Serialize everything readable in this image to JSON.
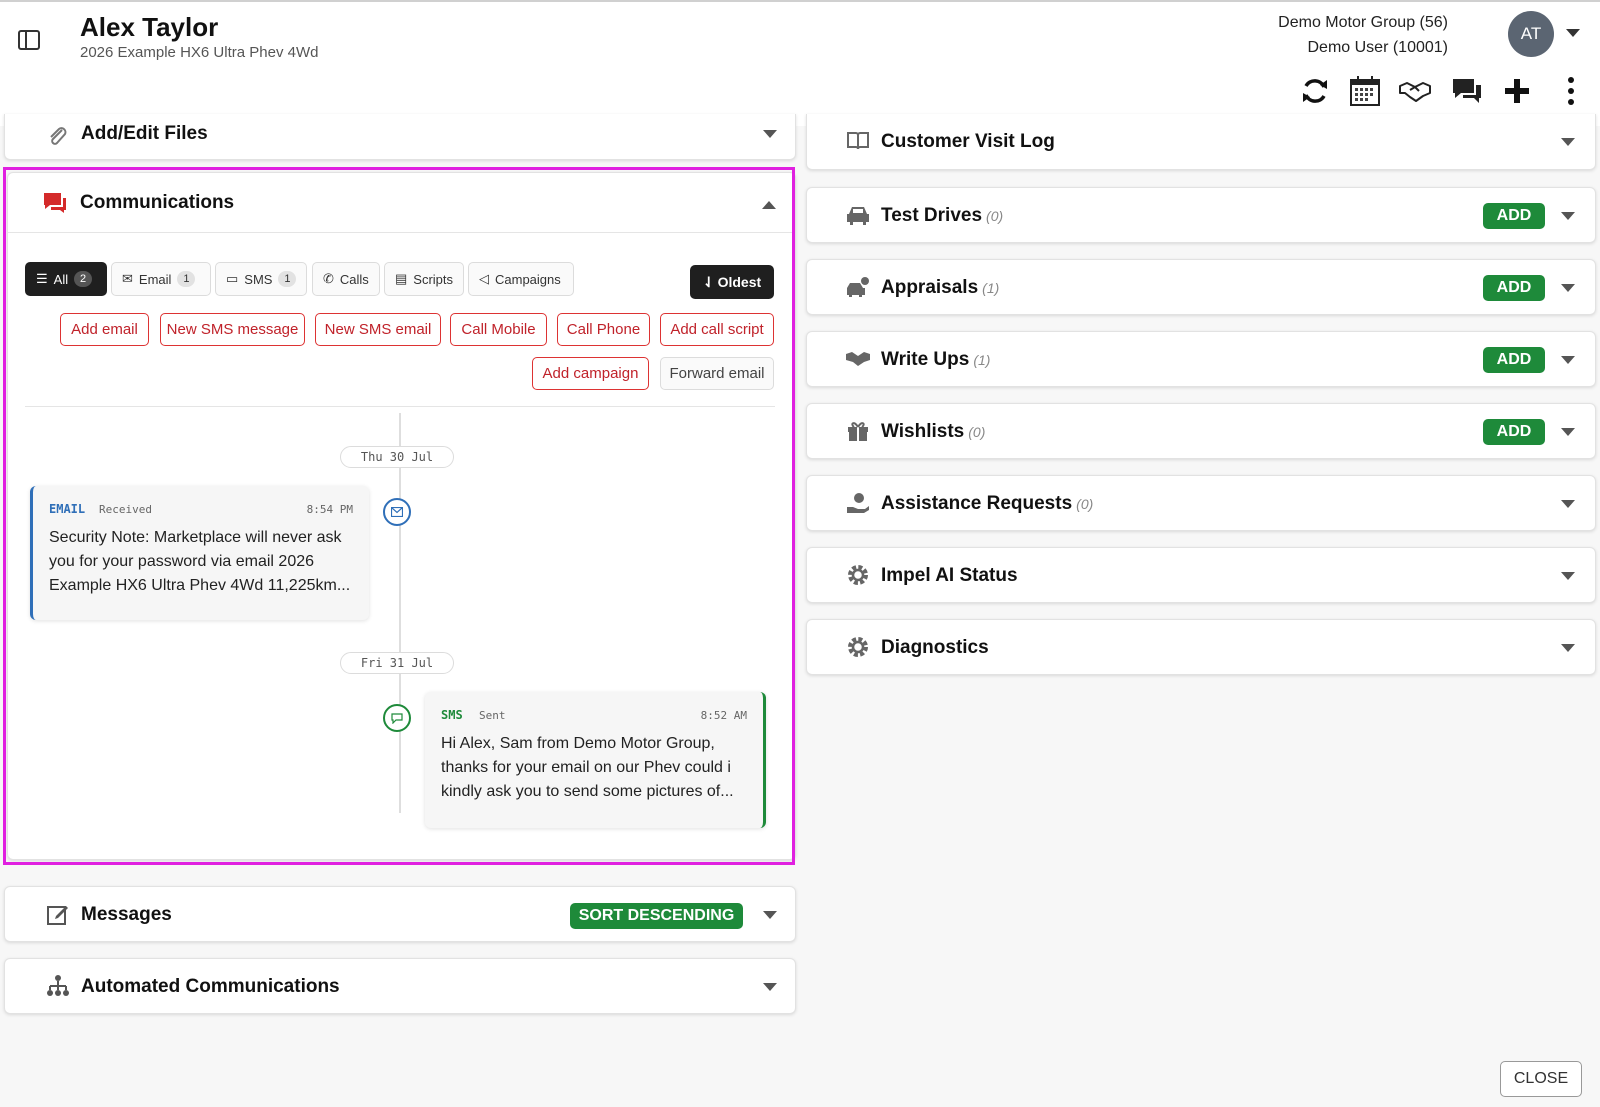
{
  "header": {
    "customer_name": "Alex Taylor",
    "vehicle": "2026 Example HX6 Ultra Phev 4Wd",
    "dealer": "Demo Motor Group (56)",
    "user": "Demo User (10001)",
    "avatar_initials": "AT"
  },
  "toolbar": {
    "icons": [
      "refresh-icon",
      "calendar-icon",
      "handshake-icon",
      "chat-icon",
      "plus-icon",
      "more-vertical-icon"
    ]
  },
  "left_panels": {
    "files": {
      "title": "Add/Edit Files"
    },
    "communications": {
      "title": "Communications",
      "tabs": [
        {
          "label": "All",
          "count": "2"
        },
        {
          "label": "Email",
          "count": "1"
        },
        {
          "label": "SMS",
          "count": "1"
        },
        {
          "label": "Calls"
        },
        {
          "label": "Scripts"
        },
        {
          "label": "Campaigns"
        }
      ],
      "sort_label": "Oldest",
      "actions": [
        "Add email",
        "New SMS message",
        "New SMS email",
        "Call Mobile",
        "Call Phone",
        "Add call script",
        "Add campaign",
        "Forward email"
      ],
      "timeline": [
        {
          "date": "Thu 30 Jul",
          "kind": "EMAIL",
          "status": "Received",
          "time": "8:54 PM",
          "body": "Security Note: Marketplace will never ask you for your password via email 2026 Example HX6 Ultra Phev 4Wd 11,225km..."
        },
        {
          "date": "Fri 31 Jul",
          "kind": "SMS",
          "status": "Sent",
          "time": "8:52 AM",
          "body": "Hi Alex, Sam from Demo Motor Group, thanks for your email on our Phev could i kindly ask you to send some pictures of..."
        }
      ]
    },
    "messages": {
      "title": "Messages",
      "sort_button": "SORT DESCENDING"
    },
    "automated": {
      "title": "Automated Communications"
    }
  },
  "right_panels": [
    {
      "title": "Customer Visit Log",
      "count": "",
      "add": ""
    },
    {
      "title": "Test Drives",
      "count": "(0)",
      "add": "ADD"
    },
    {
      "title": "Appraisals",
      "count": "(1)",
      "add": "ADD"
    },
    {
      "title": "Write Ups",
      "count": "(1)",
      "add": "ADD"
    },
    {
      "title": "Wishlists",
      "count": "(0)",
      "add": "ADD"
    },
    {
      "title": "Assistance Requests",
      "count": "(0)",
      "add": ""
    },
    {
      "title": "Impel AI Status",
      "count": "",
      "add": ""
    },
    {
      "title": "Diagnostics",
      "count": "",
      "add": ""
    }
  ],
  "footer": {
    "close_label": "CLOSE"
  },
  "colors": {
    "accent_red": "#c0222a",
    "add_green": "#1e8a3a",
    "highlight_magenta": "#e020e0",
    "email_blue": "#2f6fb8",
    "sms_green": "#1e8a3a"
  }
}
